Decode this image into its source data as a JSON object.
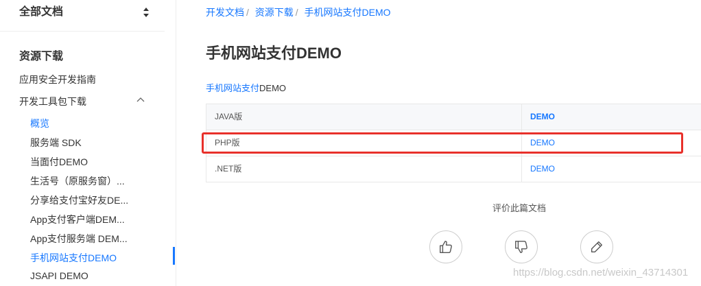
{
  "sidebar": {
    "doc_selector": "全部文档",
    "section_title": "资源下载",
    "items": [
      {
        "label": "应用安全开发指南"
      },
      {
        "label": "开发工具包下载"
      }
    ],
    "sub_items": [
      {
        "label": "概览"
      },
      {
        "label": "服务端 SDK"
      },
      {
        "label": "当面付DEMO"
      },
      {
        "label": "生活号（原服务窗）..."
      },
      {
        "label": "分享给支付宝好友DE..."
      },
      {
        "label": "App支付客户端DEM..."
      },
      {
        "label": "App支付服务端 DEM..."
      },
      {
        "label": "手机网站支付DEMO"
      },
      {
        "label": "JSAPI DEMO"
      }
    ]
  },
  "breadcrumb": [
    "开发文档",
    "资源下载",
    "手机网站支付DEMO"
  ],
  "breadcrumb_sep": "/",
  "page_title": "手机网站支付DEMO",
  "subtitle": {
    "link": "手机网站支付",
    "text": "DEMO"
  },
  "table": {
    "rows": [
      {
        "version": "JAVA版",
        "link": "DEMO"
      },
      {
        "version": "PHP版",
        "link": "DEMO"
      },
      {
        "version": ".NET版",
        "link": "DEMO"
      }
    ]
  },
  "rating": {
    "label": "评价此篇文档"
  },
  "watermark": "https://blog.csdn.net/weixin_43714301",
  "colors": {
    "accent": "#1677ff",
    "highlight": "#e8302a"
  }
}
